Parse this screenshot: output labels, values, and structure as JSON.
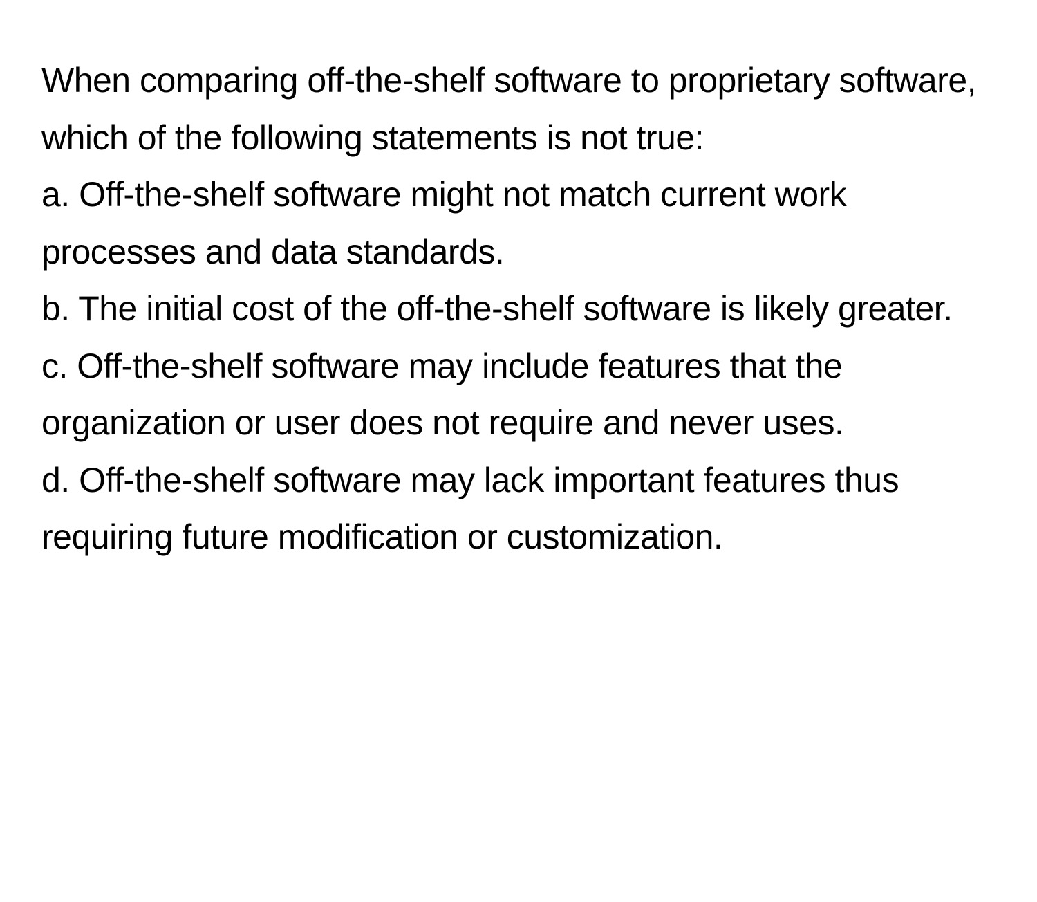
{
  "question": {
    "stem": "When comparing off-the-shelf software to proprietary software, which of the following statements is not true:",
    "options": {
      "a": "a. Off-the-shelf software might not match current work processes and data standards.",
      "b": "b. The initial cost of the off-the-shelf software is likely greater.",
      "c": "c. Off-the-shelf software may include features that the organization or user does not require and never uses.",
      "d": "d. Off-the-shelf software may lack important features thus requiring future modification or customization."
    }
  }
}
